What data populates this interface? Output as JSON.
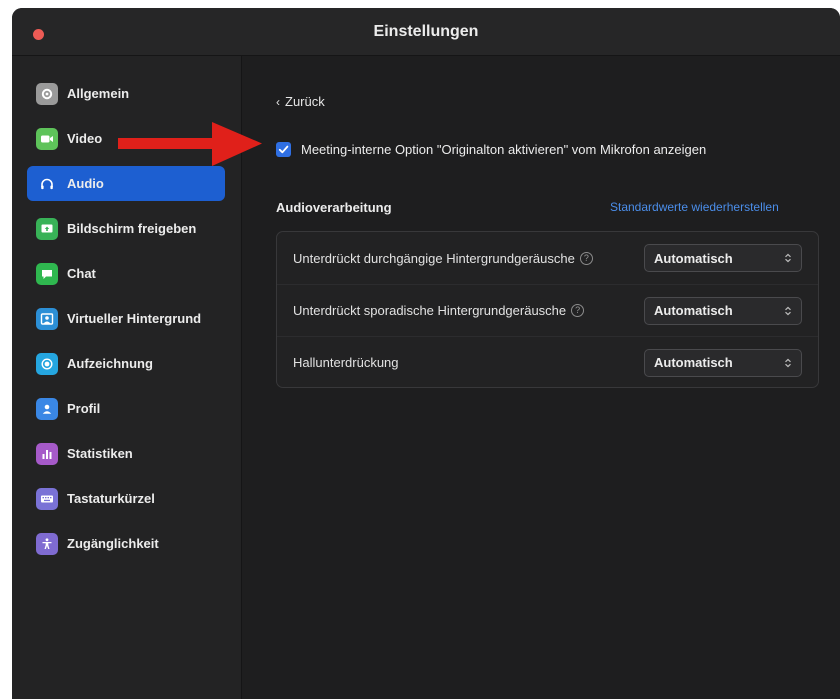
{
  "window": {
    "title": "Einstellungen"
  },
  "sidebar": {
    "items": [
      {
        "label": "Allgemein",
        "icon": "gear-icon",
        "color": "#9a9a9a",
        "active": false
      },
      {
        "label": "Video",
        "icon": "video-icon",
        "color": "#5ec35a",
        "active": false
      },
      {
        "label": "Audio",
        "icon": "headphones-icon",
        "color": "#1d5fd1",
        "active": true
      },
      {
        "label": "Bildschirm freigeben",
        "icon": "share-screen-icon",
        "color": "#38b257",
        "active": false
      },
      {
        "label": "Chat",
        "icon": "chat-icon",
        "color": "#2fb74f",
        "active": false
      },
      {
        "label": "Virtueller Hintergrund",
        "icon": "virtual-background-icon",
        "color": "#2c8fd6",
        "active": false
      },
      {
        "label": "Aufzeichnung",
        "icon": "recording-icon",
        "color": "#25a6e0",
        "active": false
      },
      {
        "label": "Profil",
        "icon": "profile-icon",
        "color": "#3a87e5",
        "active": false
      },
      {
        "label": "Statistiken",
        "icon": "statistics-icon",
        "color": "#a65ac9",
        "active": false
      },
      {
        "label": "Tastaturkürzel",
        "icon": "keyboard-icon",
        "color": "#7a72d6",
        "active": false
      },
      {
        "label": "Zugänglichkeit",
        "icon": "accessibility-icon",
        "color": "#7f6bd1",
        "active": false
      }
    ]
  },
  "main": {
    "back_label": "Zurück",
    "checkbox_label": "Meeting-interne Option \"Originalton aktivieren\" vom Mikrofon anzeigen",
    "checkbox_checked": true,
    "section_title": "Audioverarbeitung",
    "restore_label": "Standardwerte wiederherstellen",
    "settings": [
      {
        "label": "Unterdrückt durchgängige Hintergrundgeräusche",
        "has_help": true,
        "value": "Automatisch"
      },
      {
        "label": "Unterdrückt sporadische Hintergrundgeräusche",
        "has_help": true,
        "value": "Automatisch"
      },
      {
        "label": "Hallunterdrückung",
        "has_help": false,
        "value": "Automatisch"
      }
    ],
    "help_glyph": "?"
  },
  "colors": {
    "accent": "#1d5fd1",
    "link": "#4b8eea",
    "annotation_arrow": "#e0201a"
  }
}
